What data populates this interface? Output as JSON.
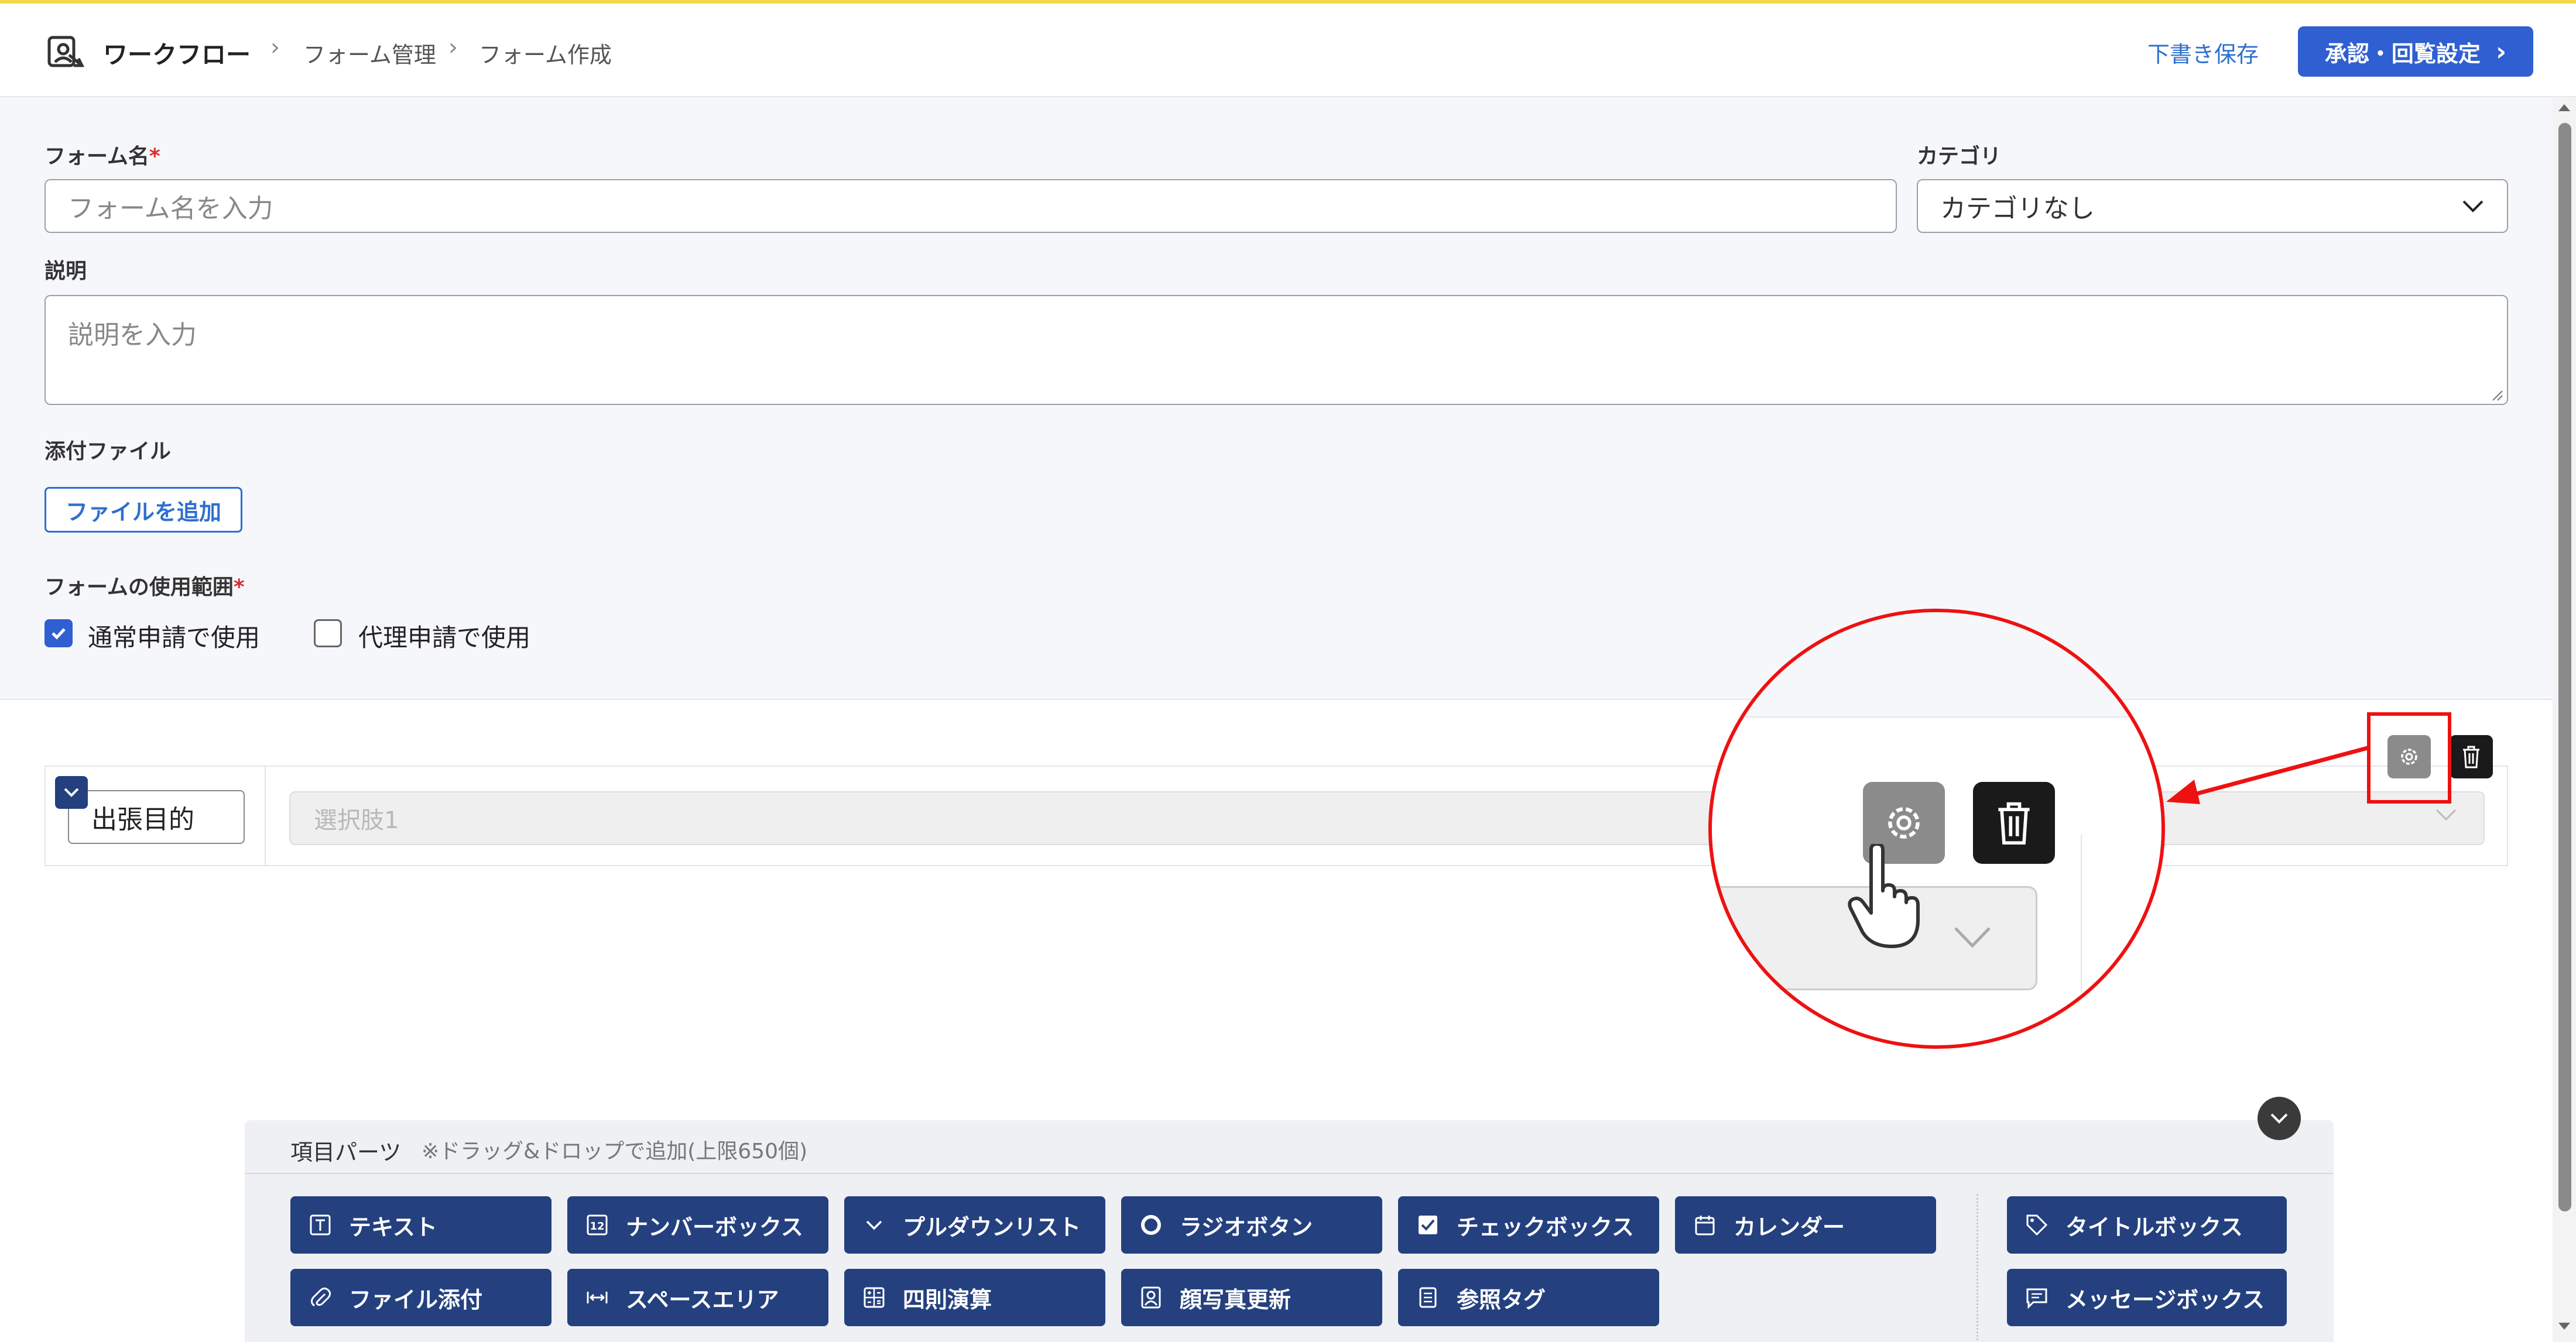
{
  "header": {
    "breadcrumb": [
      "ワークフロー",
      "フォーム管理",
      "フォーム作成"
    ],
    "save_draft": "下書き保存",
    "approve_button": "承認・回覧設定"
  },
  "form": {
    "name_label": "フォーム名",
    "name_placeholder": "フォーム名を入力",
    "category_label": "カテゴリ",
    "category_value": "カテゴリなし",
    "description_label": "説明",
    "description_placeholder": "説明を入力",
    "attachment_label": "添付ファイル",
    "add_file_button": "ファイルを追加",
    "usage_label": "フォームの使用範囲",
    "usage_options": [
      {
        "label": "通常申請で使用",
        "checked": true
      },
      {
        "label": "代理申請で使用",
        "checked": false
      }
    ],
    "required_mark": "*"
  },
  "canvas": {
    "item_title": "出張目的",
    "select_placeholder": "選択肢1"
  },
  "parts": {
    "title": "項目パーツ",
    "hint": "※ドラッグ&ドロップで追加(上限650個)",
    "row1": [
      {
        "label": "テキスト",
        "icon": "text-icon"
      },
      {
        "label": "ナンバーボックス",
        "icon": "number-icon"
      },
      {
        "label": "プルダウンリスト",
        "icon": "chevron-down-icon"
      },
      {
        "label": "ラジオボタン",
        "icon": "radio-icon"
      },
      {
        "label": "チェックボックス",
        "icon": "checkbox-icon"
      },
      {
        "label": "カレンダー",
        "icon": "calendar-icon"
      }
    ],
    "row2": [
      {
        "label": "ファイル添付",
        "icon": "paperclip-icon"
      },
      {
        "label": "スペースエリア",
        "icon": "space-icon"
      },
      {
        "label": "四則演算",
        "icon": "calculator-icon"
      },
      {
        "label": "顔写真更新",
        "icon": "portrait-icon"
      },
      {
        "label": "参照タグ",
        "icon": "list-icon"
      }
    ],
    "side": [
      {
        "label": "タイトルボックス",
        "icon": "tag-icon"
      },
      {
        "label": "メッセージボックス",
        "icon": "message-icon"
      }
    ]
  },
  "colors": {
    "accent": "#2f5fd0",
    "part_button": "#24407e",
    "highlight": "#ee1111"
  }
}
